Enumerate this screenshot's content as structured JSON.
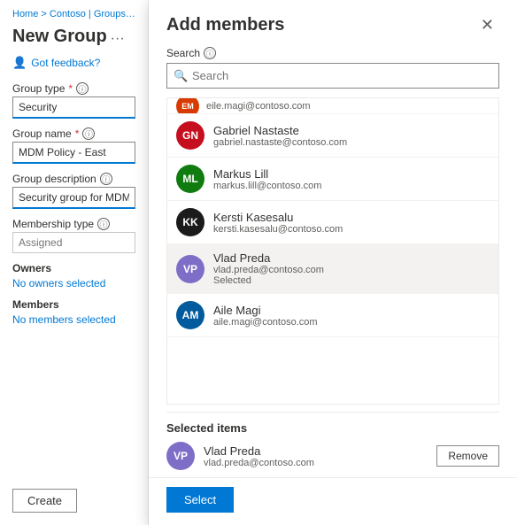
{
  "breadcrumb": {
    "text": "Home > Contoso | Groups > Gr..."
  },
  "left_panel": {
    "page_title": "New Group",
    "more_options_icon": "···",
    "feedback": {
      "icon": "👤",
      "label": "Got feedback?"
    },
    "fields": {
      "group_type": {
        "label": "Group type",
        "required": true,
        "value": "Security"
      },
      "group_name": {
        "label": "Group name",
        "required": true,
        "value": "MDM Policy - East"
      },
      "group_description": {
        "label": "Group description",
        "value": "Security group for MDM East"
      },
      "membership_type": {
        "label": "Membership type",
        "placeholder": "Assigned"
      }
    },
    "owners": {
      "label": "Owners",
      "link": "No owners selected"
    },
    "members": {
      "label": "Members",
      "link": "No members selected"
    },
    "create_button": "Create"
  },
  "dialog": {
    "title": "Add members",
    "close_icon": "✕",
    "search": {
      "label": "Search",
      "placeholder": "Search"
    },
    "members_list": [
      {
        "initials": "GN",
        "name": "Gabriel Nastaste",
        "email": "gabriel.nastaste@contoso.com",
        "color": "#c50f1f",
        "selected": false
      },
      {
        "initials": "ML",
        "name": "Markus Lill",
        "email": "markus.lill@contoso.com",
        "color": "#107c10",
        "selected": false
      },
      {
        "initials": "KK",
        "name": "Kersti Kasesalu",
        "email": "kersti.kasesalu@contoso.com",
        "color": "#1b1b1b",
        "selected": false
      },
      {
        "initials": "VP",
        "name": "Vlad Preda",
        "email": "vlad.preda@contoso.com",
        "color": "#7f6ec7",
        "selected": true,
        "selected_label": "Selected"
      },
      {
        "initials": "AM",
        "name": "Aile Magi",
        "email": "aile.magi@contoso.com",
        "color": "#005a9e",
        "selected": false
      }
    ],
    "selected_items_section": {
      "title": "Selected items",
      "selected_member": {
        "initials": "VP",
        "name": "Vlad Preda",
        "email": "vlad.preda@contoso.com",
        "color": "#7f6ec7"
      },
      "remove_button": "Remove"
    },
    "select_button": "Select"
  }
}
